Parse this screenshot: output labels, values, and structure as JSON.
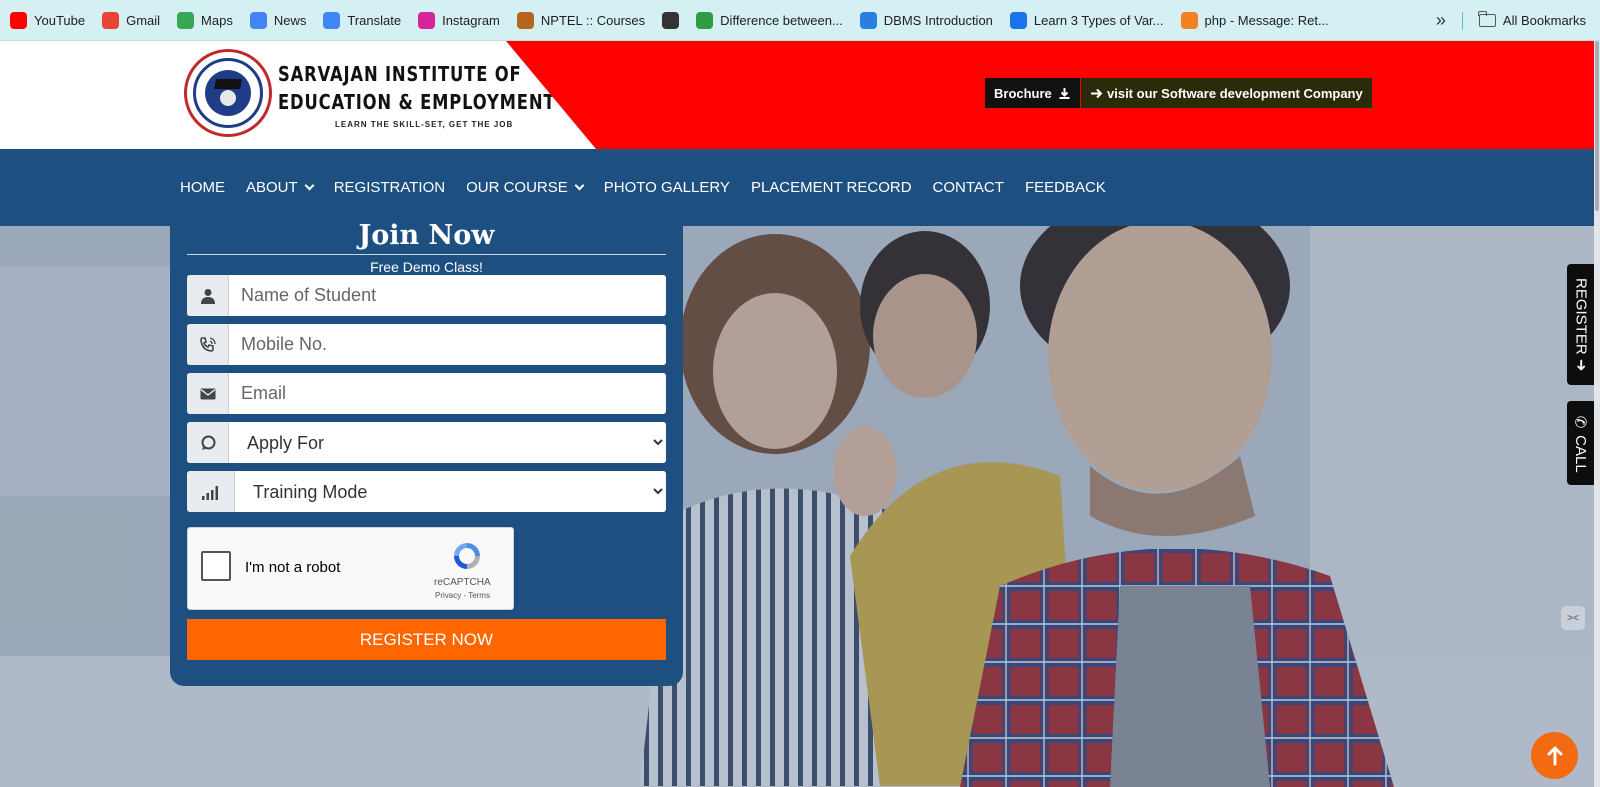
{
  "bookmarks": {
    "items": [
      {
        "label": "YouTube",
        "icon": "youtube-icon",
        "color": "#ff0000"
      },
      {
        "label": "Gmail",
        "icon": "gmail-icon",
        "color": "#ea4335"
      },
      {
        "label": "Maps",
        "icon": "maps-icon",
        "color": "#34a853"
      },
      {
        "label": "News",
        "icon": "news-icon",
        "color": "#4285f4"
      },
      {
        "label": "Translate",
        "icon": "translate-icon",
        "color": "#4285f4"
      },
      {
        "label": "Instagram",
        "icon": "instagram-icon",
        "color": "#d6249f"
      },
      {
        "label": "NPTEL :: Courses",
        "icon": "nptel-icon",
        "color": "#b5651d"
      },
      {
        "label": "",
        "icon": "globe-icon",
        "color": "#333333"
      },
      {
        "label": "Difference between...",
        "icon": "difference-icon",
        "color": "#2e9e44"
      },
      {
        "label": "DBMS Introduction",
        "icon": "dbms-icon",
        "color": "#2a7de1"
      },
      {
        "label": "Learn 3 Types of Var...",
        "icon": "learn-icon",
        "color": "#1a73e8"
      },
      {
        "label": "php - Message: Ret...",
        "icon": "php-icon",
        "color": "#f48024"
      }
    ],
    "all_bookmarks_label": "All Bookmarks",
    "overflow_label": "»"
  },
  "header": {
    "institute_line1": "SARVAJAN INSTITUTE OF",
    "institute_line2": "EDUCATION & EMPLOYMENT",
    "tagline": "LEARN THE SKILL-SET, GET THE JOB",
    "brochure_label": "Brochure",
    "visit_label": "visit our Software development Company",
    "accent_red": "#fe0000"
  },
  "nav": {
    "items": [
      {
        "label": "HOME",
        "has_dropdown": false
      },
      {
        "label": "ABOUT",
        "has_dropdown": true
      },
      {
        "label": "REGISTRATION",
        "has_dropdown": false
      },
      {
        "label": "OUR COURSE",
        "has_dropdown": true
      },
      {
        "label": "PHOTO GALLERY",
        "has_dropdown": false
      },
      {
        "label": "PLACEMENT RECORD",
        "has_dropdown": false
      },
      {
        "label": "CONTACT",
        "has_dropdown": false
      },
      {
        "label": "FEEDBACK",
        "has_dropdown": false
      }
    ],
    "background": "#1d5081"
  },
  "form": {
    "title": "Join Now",
    "subtitle": "Free Demo Class!",
    "name_placeholder": "Name of Student",
    "mobile_placeholder": "Mobile No.",
    "email_placeholder": "Email",
    "apply_for_selected": "Apply For",
    "training_mode_selected": "Training Mode",
    "captcha_label": "I'm not a robot",
    "captcha_brand": "reCAPTCHA",
    "captcha_links": "Privacy - Terms",
    "submit_label": "REGISTER NOW",
    "submit_color": "#ff6600"
  },
  "side": {
    "register_label": "REGISTER ➜",
    "call_label": "CALL",
    "scroll_top_color": "#f26a12"
  }
}
